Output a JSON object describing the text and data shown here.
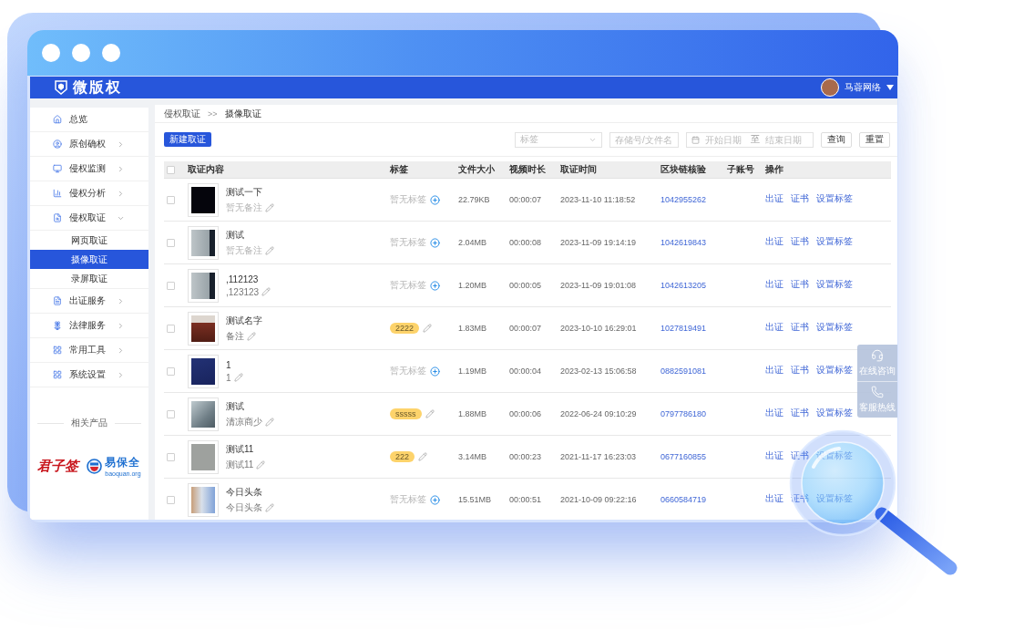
{
  "header": {
    "logo": "微版权",
    "user": {
      "name": "马蓉网络"
    }
  },
  "sidebar": {
    "items": [
      {
        "label": "总览",
        "selected": false
      },
      {
        "label": "原创确权",
        "selected": false,
        "expanded": false
      },
      {
        "label": "侵权监测",
        "selected": false,
        "expanded": false
      },
      {
        "label": "侵权分析",
        "selected": false,
        "expanded": false
      },
      {
        "label": "侵权取证",
        "selected": false,
        "expanded": true,
        "children": [
          {
            "label": "网页取证",
            "selected": false
          },
          {
            "label": "摄像取证",
            "selected": true
          },
          {
            "label": "录屏取证",
            "selected": false
          }
        ]
      },
      {
        "label": "出证服务",
        "selected": false,
        "expanded": false
      },
      {
        "label": "法律服务",
        "selected": false,
        "expanded": false
      },
      {
        "label": "常用工具",
        "selected": false,
        "expanded": false
      },
      {
        "label": "系统设置",
        "selected": false,
        "expanded": false
      }
    ],
    "related_title": "相关产品",
    "products": [
      {
        "kind": "script",
        "name": "君子签"
      },
      {
        "kind": "emblem",
        "name": "易保全",
        "domain": "baoquan.org"
      }
    ]
  },
  "breadcrumb": {
    "items": [
      "侵权取证",
      "摄像取证"
    ],
    "separator": ">>"
  },
  "toolbar": {
    "create_button": "新建取证",
    "tag_select": {
      "placeholder": "标签"
    },
    "search": {
      "placeholder": "存储号/文件名"
    },
    "date_range": {
      "start_placeholder": "开始日期",
      "separator": "至",
      "end_placeholder": "结束日期"
    },
    "buttons": [
      "查询",
      "重置"
    ]
  },
  "table": {
    "all_checked": false,
    "columns": [
      "取证内容",
      "标签",
      "文件大小",
      "视频时长",
      "取证时间",
      "区块链核验",
      "子账号",
      "操作"
    ],
    "rows": [
      {
        "checked": false,
        "thumbnail": {
          "kind": "dark"
        },
        "title": "测试一下",
        "note": {
          "kind": "empty",
          "text": "暂无备注"
        },
        "tag": {
          "kind": "empty",
          "text": "暂无标签"
        },
        "size": "22.79KB",
        "duration": "00:00:07",
        "time": "2023-11-10 11:18:52",
        "chain": "1042955262",
        "actions": [
          "出证",
          "证书",
          "设置标签"
        ]
      },
      {
        "checked": false,
        "thumbnail": {
          "kind": "building"
        },
        "title": "测试",
        "note": {
          "kind": "empty",
          "text": "暂无备注"
        },
        "tag": {
          "kind": "empty",
          "text": "暂无标签"
        },
        "size": "2.04MB",
        "duration": "00:00:08",
        "time": "2023-11-09 19:14:19",
        "chain": "1042619843",
        "actions": [
          "出证",
          "证书",
          "设置标签"
        ]
      },
      {
        "checked": false,
        "thumbnail": {
          "kind": "building"
        },
        "title": ",112123",
        "note": {
          "kind": "value",
          "text": ",123123"
        },
        "tag": {
          "kind": "empty",
          "text": "暂无标签"
        },
        "size": "1.20MB",
        "duration": "00:00:05",
        "time": "2023-11-09 19:01:08",
        "chain": "1042613205",
        "actions": [
          "出证",
          "证书",
          "设置标签"
        ]
      },
      {
        "checked": false,
        "thumbnail": {
          "kind": "room"
        },
        "title": "测试名字",
        "note": {
          "kind": "value",
          "text": "备注"
        },
        "tag": {
          "kind": "tag",
          "text": "2222"
        },
        "size": "1.83MB",
        "duration": "00:00:07",
        "time": "2023-10-10 16:29:01",
        "chain": "1027819491",
        "actions": [
          "出证",
          "证书",
          "设置标签"
        ]
      },
      {
        "checked": false,
        "thumbnail": {
          "kind": "screen"
        },
        "title": "1",
        "note": {
          "kind": "value",
          "text": "1"
        },
        "tag": {
          "kind": "empty",
          "text": "暂无标签"
        },
        "size": "1.19MB",
        "duration": "00:00:04",
        "time": "2023-02-13 15:06:58",
        "chain": "0882591081",
        "actions": [
          "出证",
          "证书",
          "设置标签"
        ]
      },
      {
        "checked": false,
        "thumbnail": {
          "kind": "office"
        },
        "title": "测试",
        "note": {
          "kind": "value",
          "text": "清凉商少"
        },
        "tag": {
          "kind": "tag",
          "text": "sssss"
        },
        "size": "1.88MB",
        "duration": "00:00:06",
        "time": "2022-06-24 09:10:29",
        "chain": "0797786180",
        "actions": [
          "出证",
          "证书",
          "设置标签"
        ]
      },
      {
        "checked": false,
        "thumbnail": {
          "kind": "blank"
        },
        "title": "测试11",
        "note": {
          "kind": "value",
          "text": "测试11"
        },
        "tag": {
          "kind": "tag",
          "text": "222"
        },
        "size": "3.14MB",
        "duration": "00:00:23",
        "time": "2021-11-17 16:23:03",
        "chain": "0677160855",
        "actions": [
          "出证",
          "证书",
          "设置标签"
        ]
      },
      {
        "checked": false,
        "thumbnail": {
          "kind": "desk"
        },
        "title": "今日头条",
        "note": {
          "kind": "value",
          "text": "今日头条"
        },
        "tag": {
          "kind": "empty",
          "text": "暂无标签"
        },
        "size": "15.51MB",
        "duration": "00:00:51",
        "time": "2021-10-09 09:22:16",
        "chain": "0660584719",
        "actions": [
          "出证",
          "证书",
          "设置标签"
        ]
      }
    ]
  },
  "side_panel": {
    "items": [
      {
        "kind": "chat",
        "label": "在线咨询"
      },
      {
        "kind": "phone",
        "label": "客服热线"
      }
    ]
  }
}
